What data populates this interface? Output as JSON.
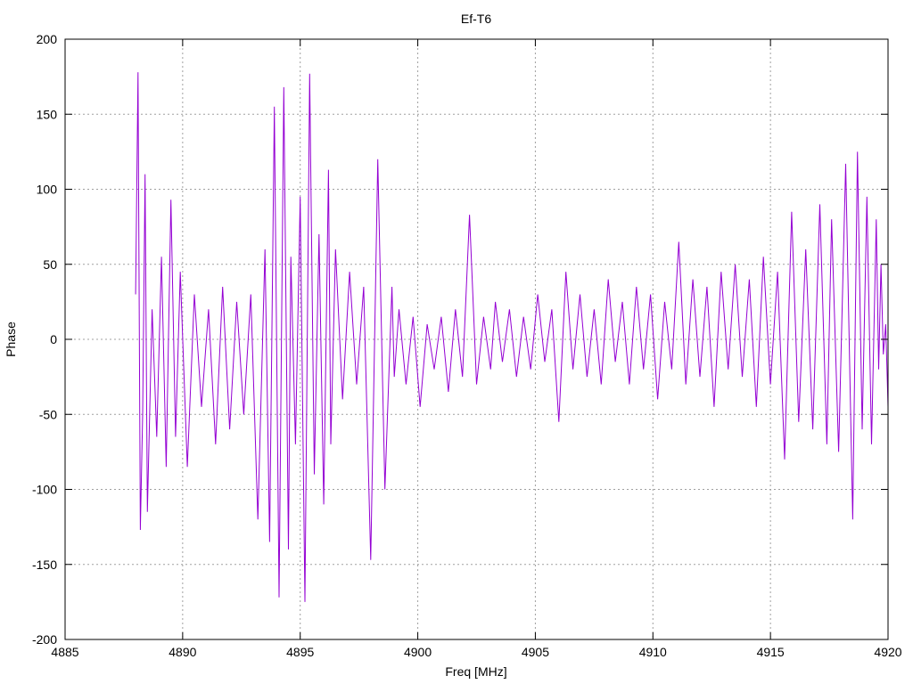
{
  "chart_data": {
    "type": "line",
    "title": "Ef-T6",
    "xlabel": "Freq [MHz]",
    "ylabel": "Phase",
    "xlim": [
      4885,
      4920
    ],
    "ylim": [
      -200,
      200
    ],
    "x_ticks": [
      4885,
      4890,
      4895,
      4900,
      4905,
      4910,
      4915,
      4920
    ],
    "y_ticks": [
      -200,
      -150,
      -100,
      -50,
      0,
      50,
      100,
      150,
      200
    ],
    "grid": true,
    "line_color": "#9400d3",
    "grid_color": "#a0a0a0",
    "series": [
      {
        "x": [
          4888.0,
          4888.1,
          4888.2,
          4888.3,
          4888.4,
          4888.5,
          4888.7,
          4888.9,
          4889.1,
          4889.3,
          4889.5,
          4889.7,
          4889.9,
          4890.2,
          4890.5,
          4890.8,
          4891.1,
          4891.4,
          4891.7,
          4892.0,
          4892.3,
          4892.6,
          4892.9,
          4893.2,
          4893.5,
          4893.7,
          4893.9,
          4894.1,
          4894.3,
          4894.5,
          4894.6,
          4894.8,
          4895.0,
          4895.2,
          4895.4,
          4895.6,
          4895.8,
          4896.0,
          4896.2,
          4896.3,
          4896.5,
          4896.8,
          4897.1,
          4897.4,
          4897.7,
          4898.0,
          4898.3,
          4898.6,
          4898.9,
          4899.0,
          4899.2,
          4899.5,
          4899.8,
          4900.1,
          4900.4,
          4900.7,
          4901.0,
          4901.3,
          4901.6,
          4901.9,
          4902.2,
          4902.5,
          4902.8,
          4903.1,
          4903.3,
          4903.6,
          4903.9,
          4904.2,
          4904.5,
          4904.8,
          4905.1,
          4905.4,
          4905.7,
          4906.0,
          4906.3,
          4906.6,
          4906.9,
          4907.2,
          4907.5,
          4907.8,
          4908.1,
          4908.4,
          4908.7,
          4909.0,
          4909.3,
          4909.6,
          4909.9,
          4910.2,
          4910.5,
          4910.8,
          4911.1,
          4911.4,
          4911.7,
          4912.0,
          4912.3,
          4912.6,
          4912.9,
          4913.2,
          4913.5,
          4913.8,
          4914.1,
          4914.4,
          4914.7,
          4915.0,
          4915.3,
          4915.6,
          4915.9,
          4916.2,
          4916.5,
          4916.8,
          4917.1,
          4917.4,
          4917.6,
          4917.9,
          4918.2,
          4918.5,
          4918.7,
          4918.9,
          4919.1,
          4919.3,
          4919.5,
          4919.6,
          4919.7,
          4919.8,
          4919.9,
          4920.0
        ],
        "y": [
          30,
          178,
          -127,
          -50,
          110,
          -115,
          20,
          -65,
          55,
          -85,
          93,
          -65,
          45,
          -85,
          30,
          -45,
          20,
          -70,
          35,
          -60,
          25,
          -50,
          30,
          -120,
          60,
          -135,
          155,
          -172,
          168,
          -140,
          55,
          -70,
          95,
          -175,
          177,
          -90,
          70,
          -110,
          113,
          -70,
          60,
          -40,
          45,
          -30,
          35,
          -147,
          120,
          -100,
          35,
          -25,
          20,
          -30,
          15,
          -45,
          10,
          -20,
          15,
          -35,
          20,
          -25,
          83,
          -30,
          15,
          -20,
          25,
          -15,
          20,
          -25,
          15,
          -20,
          30,
          -15,
          20,
          -55,
          45,
          -20,
          30,
          -25,
          20,
          -30,
          40,
          -15,
          25,
          -30,
          35,
          -20,
          30,
          -40,
          25,
          -20,
          65,
          -30,
          40,
          -25,
          35,
          -45,
          45,
          -20,
          50,
          -25,
          40,
          -45,
          55,
          -30,
          45,
          -80,
          85,
          -55,
          60,
          -60,
          90,
          -70,
          80,
          -75,
          117,
          -120,
          125,
          -60,
          95,
          -70,
          80,
          -20,
          50,
          -10,
          10,
          -45
        ]
      }
    ]
  }
}
